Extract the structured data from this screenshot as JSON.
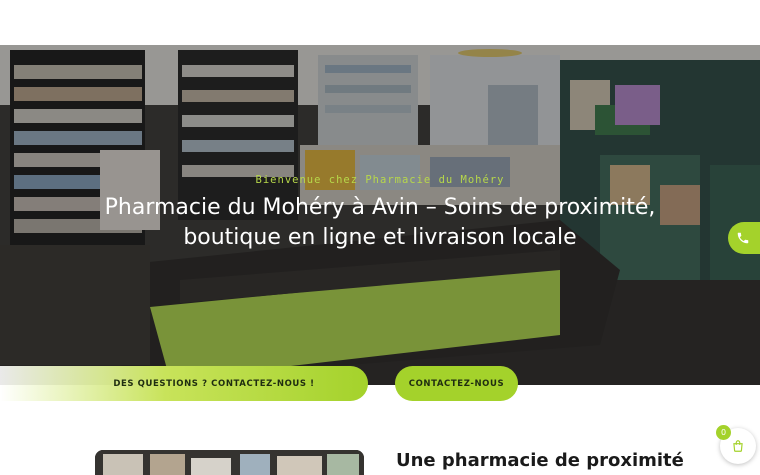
{
  "hero": {
    "subtitle": "Bienvenue chez Pharmacie du Mohéry",
    "title": "Pharmacie du Mohéry à Avin – Soins de proximité, boutique en ligne et livraison locale"
  },
  "buttons": {
    "questions_label": "DES QUESTIONS ? CONTACTEZ-NOUS !",
    "contact_label": "CONTACTEZ-NOUS"
  },
  "about": {
    "heading": "Une pharmacie de proximité"
  },
  "cart": {
    "count": "0"
  },
  "icons": {
    "phone": "phone-icon",
    "cart": "shopping-bag-icon"
  },
  "colors": {
    "accent": "#a4d22b",
    "subtitle": "#b7d84a",
    "title": "#ffffff",
    "dark_text": "#1a1a1a"
  }
}
